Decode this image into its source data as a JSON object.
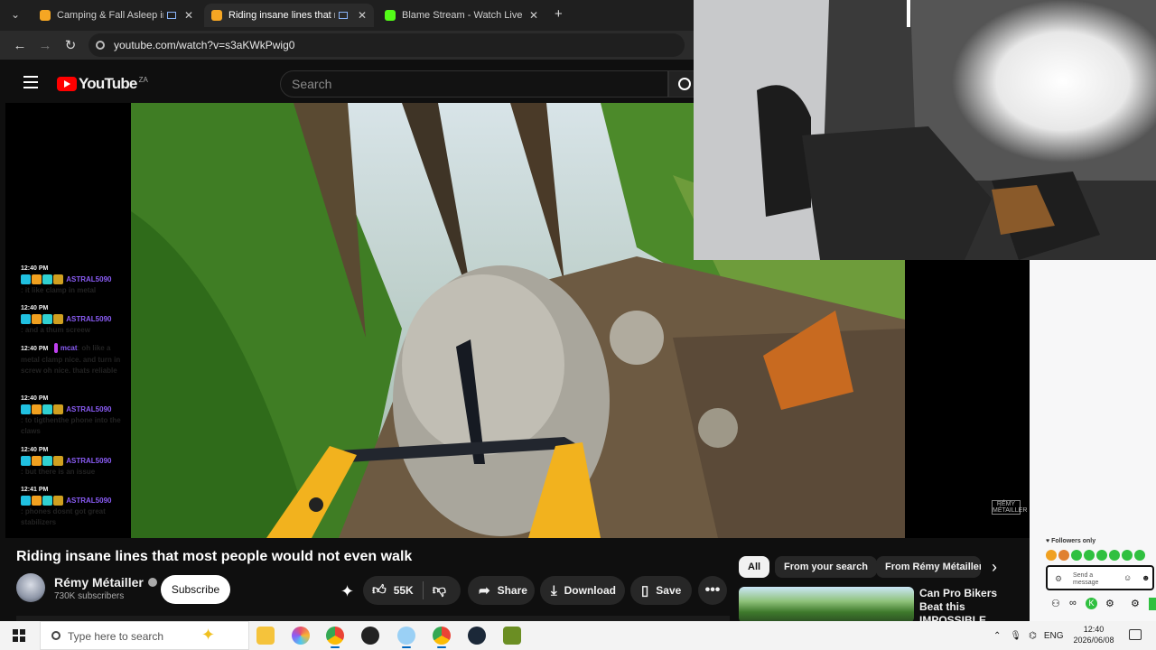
{
  "browser": {
    "tabs": [
      {
        "title": "Camping & Fall Asleep in H",
        "color": "#f5a623"
      },
      {
        "title": "Riding insane lines that mo",
        "color": "#f5a623",
        "active": true
      },
      {
        "title": "Blame Stream - Watch Live on",
        "color": "#53fc18"
      }
    ],
    "new_tab": "+",
    "tab_menu": "⌄",
    "close": "✕",
    "url": "youtube.com/watch?v=s3aKWkPwig0"
  },
  "youtube": {
    "logo_text": "YouTube",
    "country": "ZA",
    "search_placeholder": "Search",
    "video_watermark": "RÉMY MÉTAILLER",
    "video_title": "Riding insane lines that most people would not even walk",
    "channel_name": "Rémy Métailler",
    "subscribers": "730K subscribers",
    "subscribe_label": "Subscribe",
    "likes": "55K",
    "share_label": "Share",
    "download_label": "Download",
    "save_label": "Save",
    "more_label": "•••",
    "chips": [
      "All",
      "From your search",
      "From Rémy Métailler"
    ],
    "rec_title": "Can Pro Bikers Beat this IMPOSSIBLE Obstacle Course?"
  },
  "chat": {
    "messages": [
      {
        "time": "12:40 PM",
        "user": "ASTRAL5090",
        "text": ": it like clamp in metal",
        "color": "#8a5cf5"
      },
      {
        "time": "12:40 PM",
        "user": "ASTRAL5090",
        "text": ": and a thum screew",
        "color": "#8a5cf5"
      },
      {
        "time": "12:40 PM",
        "user": "mcat",
        "text": ": oh like a metal clamp nice. and turn in screw oh nice. thats reliable",
        "color": "#8a5cf5"
      },
      {
        "time": "12:40 PM",
        "user": "ASTRAL5090",
        "text": ": to tigthenthe phone into the claws",
        "color": "#8a5cf5"
      },
      {
        "time": "12:40 PM",
        "user": "ASTRAL5090",
        "text": ": but there is an issue",
        "color": "#8a5cf5"
      },
      {
        "time": "12:41 PM",
        "user": "ASTRAL5090",
        "text": ": phones dosnt got great stabilizers",
        "color": "#8a5cf5"
      }
    ],
    "followers_only": "Followers only",
    "input_placeholder": "Send a message"
  },
  "taskbar": {
    "search_placeholder": "Type here to search",
    "lang": "ENG",
    "time": "12:40",
    "date": "2026/06/08"
  }
}
